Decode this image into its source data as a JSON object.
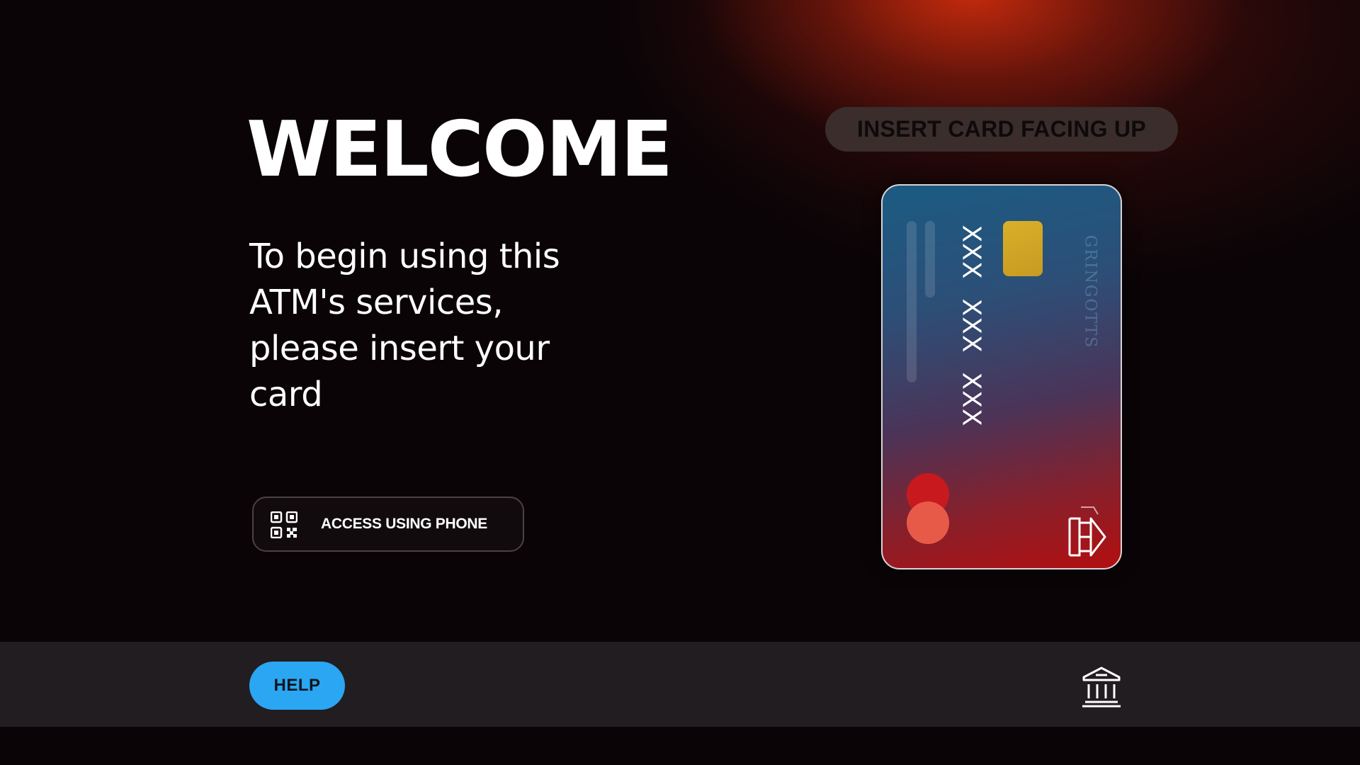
{
  "welcome": {
    "title": "WELCOME",
    "instructions": "To begin using this ATM's services, please insert your card"
  },
  "phone_access": {
    "label": "ACCESS USING PHONE",
    "icon": "qr-code-icon"
  },
  "insert_hint": {
    "label": "INSERT CARD FACING UP"
  },
  "card": {
    "number_groups": [
      "XXX",
      "XXX",
      "XXX"
    ],
    "bank_name": "GRINGOTTS",
    "chip_color": "#d0a82a",
    "logo_icon": "bank-logo-icon"
  },
  "footer": {
    "help_label": "HELP",
    "bank_icon": "bank-building-icon"
  },
  "colors": {
    "background": "#0a0407",
    "accent_glow": "#cd2c0c",
    "help_button": "#2aa6f2",
    "footer_bar": "#221d20",
    "hint_pill": "#3a2d2b"
  }
}
